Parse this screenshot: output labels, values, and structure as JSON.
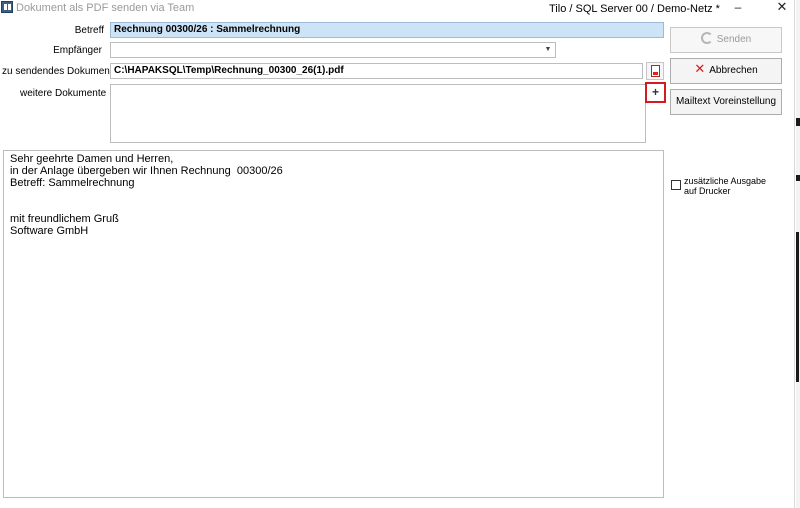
{
  "window": {
    "title": "Dokument als PDF senden via Team",
    "right_status": "Tilo / SQL Server 00 / Demo-Netz *",
    "minimize": "–",
    "close": "✕"
  },
  "form": {
    "subject_label": "Betreff",
    "subject_value": "Rechnung 00300/26 : Sammelrechnung",
    "recipient_label": "Empfänger",
    "recipient_value": "",
    "document_label": "zu sendendes Dokument",
    "document_value": "C:\\HAPAKSQL\\Temp\\Rechnung_00300_26(1).pdf",
    "more_docs_label": "weitere Dokumente",
    "add_symbol": "+"
  },
  "buttons": {
    "send": "Senden",
    "cancel": "Abbrechen",
    "mailtext": "Mailtext Voreinstellung"
  },
  "mail_body": {
    "lines": [
      "Sehr geehrte Damen und Herren,",
      "in der Anlage übergeben wir Ihnen Rechnung  00300/26",
      "Betreff: Sammelrechnung",
      "",
      "",
      "mit freundlichem Gruß",
      "Software GmbH"
    ]
  },
  "printer_option": {
    "label": "zusätzliche Ausgabe auf Drucker",
    "checked": false
  },
  "icons": {
    "app": "app-logo-icon",
    "pdf": "pdf-file-icon",
    "send": "refresh-icon",
    "cancel": "red-x-icon",
    "dropdown": "chevron-down-icon"
  },
  "colors": {
    "subject_bg": "#cde3f6",
    "add_highlight": "#d4191f",
    "cancel_icon": "#d01e1e"
  }
}
